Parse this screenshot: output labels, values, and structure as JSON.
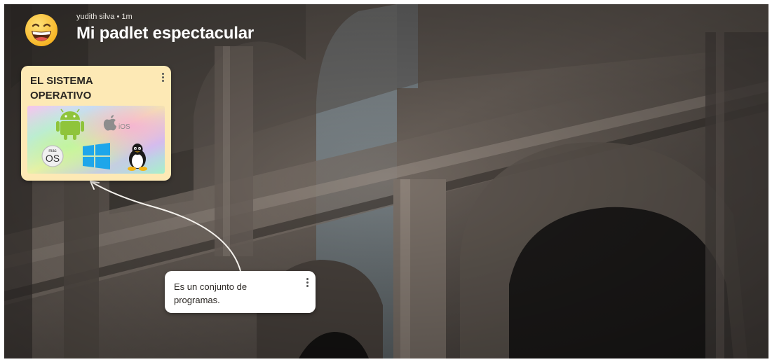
{
  "header": {
    "author": "yudith silva",
    "separator": "•",
    "time_ago": "1m",
    "title": "Mi padlet espectacular"
  },
  "posts": [
    {
      "title": "EL SISTEMA OPERATIVO",
      "image_logos": [
        "android-icon",
        "apple-ios-icon",
        "macos-icon",
        "windows-icon",
        "linux-tux-icon"
      ],
      "image_text": {
        "ios": "iOS",
        "mac": "mac",
        "os": "OS"
      }
    },
    {
      "body": "Es un conjunto de programas."
    }
  ],
  "colors": {
    "post_card": "#fde9b5",
    "text_card": "#ffffff",
    "connector": "#f4f1ec"
  }
}
